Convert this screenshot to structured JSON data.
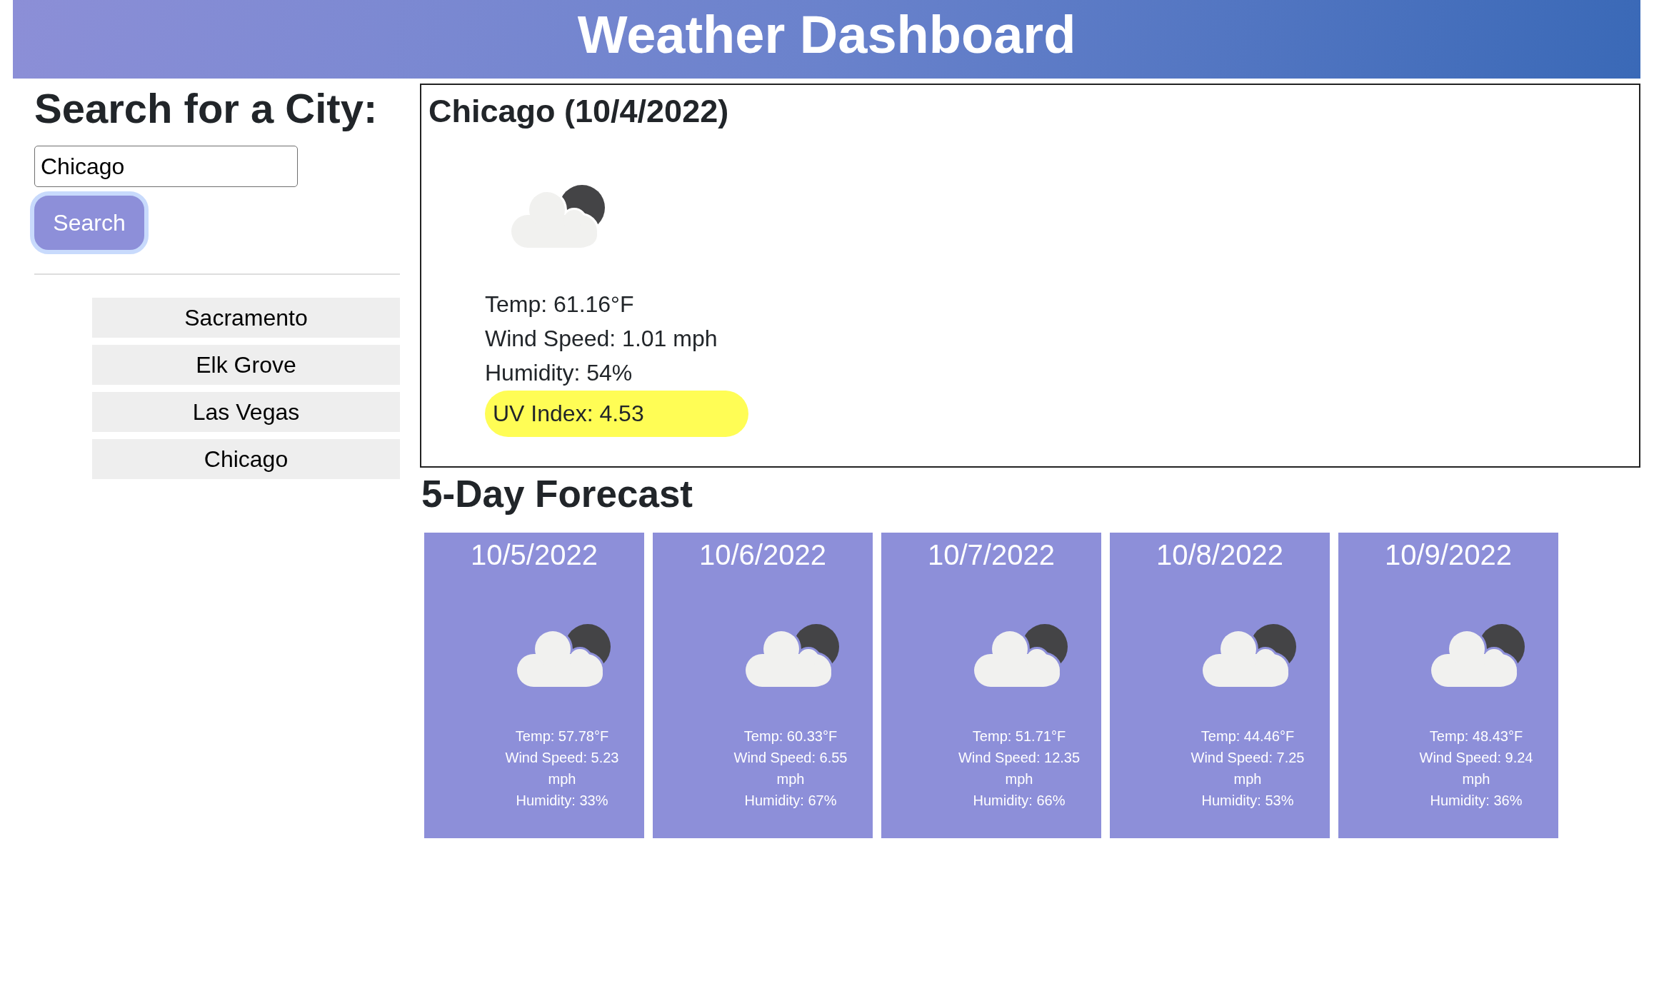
{
  "header": {
    "title": "Weather Dashboard"
  },
  "search": {
    "heading": "Search for a City:",
    "input": {
      "value": "Chicago"
    },
    "button": {
      "label": "Search",
      "focused": true
    }
  },
  "history": [
    {
      "label": "Sacramento"
    },
    {
      "label": "Elk Grove"
    },
    {
      "label": "Las Vegas"
    },
    {
      "label": "Chicago"
    }
  ],
  "current": {
    "title": "Chicago (10/4/2022)",
    "details": [
      {
        "kind": "text",
        "text": "Temp: 61.16°F"
      },
      {
        "kind": "text",
        "text": "Wind Speed: 1.01 mph"
      },
      {
        "kind": "text",
        "text": "Humidity: 54%"
      },
      {
        "kind": "badge",
        "text": "UV Index: 4.53",
        "color": "#fffd55"
      }
    ]
  },
  "forecast": {
    "heading": "5-Day Forecast",
    "days": [
      {
        "date": "10/5/2022",
        "details": [
          "Temp: 57.78°F",
          "Wind Speed: 5.23 mph",
          "Humidity: 33%"
        ]
      },
      {
        "date": "10/6/2022",
        "details": [
          "Temp: 60.33°F",
          "Wind Speed: 6.55 mph",
          "Humidity: 67%"
        ]
      },
      {
        "date": "10/7/2022",
        "details": [
          "Temp: 51.71°F",
          "Wind Speed: 12.35 mph",
          "Humidity: 66%"
        ]
      },
      {
        "date": "10/8/2022",
        "details": [
          "Temp: 44.46°F",
          "Wind Speed: 7.25 mph",
          "Humidity: 53%"
        ]
      },
      {
        "date": "10/9/2022",
        "details": [
          "Temp: 48.43°F",
          "Wind Speed: 9.24 mph",
          "Humidity: 36%"
        ]
      }
    ]
  }
}
